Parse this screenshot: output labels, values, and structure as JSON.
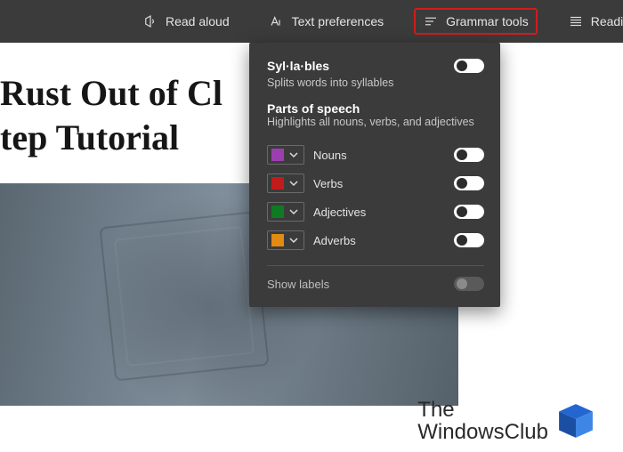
{
  "toolbar": {
    "read_aloud": "Read aloud",
    "text_prefs": "Text preferences",
    "grammar_tools": "Grammar tools",
    "reading_prefs": "Reading prefere"
  },
  "page": {
    "heading_line1": "Rust Out of Cl",
    "heading_line2": "tep Tutorial"
  },
  "dropdown": {
    "syllables_title": "Syl·la·bles",
    "syllables_desc": "Splits words into syllables",
    "pos_title": "Parts of speech",
    "pos_desc": "Highlights all nouns, verbs, and adjectives",
    "items": [
      {
        "label": "Nouns",
        "color": "#9b3fb0"
      },
      {
        "label": "Verbs",
        "color": "#c21b1b"
      },
      {
        "label": "Adjectives",
        "color": "#0f7a22"
      },
      {
        "label": "Adverbs",
        "color": "#e28a12"
      }
    ],
    "show_labels": "Show labels"
  },
  "brand": {
    "line1": "The",
    "line2": "WindowsClub"
  }
}
